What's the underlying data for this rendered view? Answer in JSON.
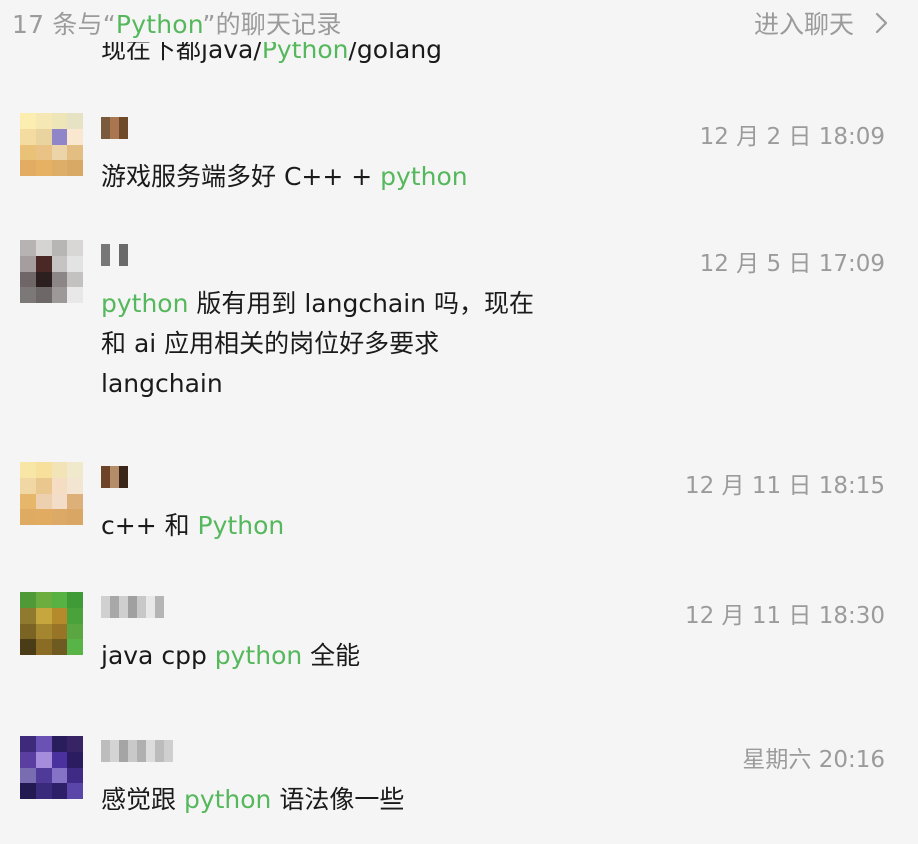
{
  "header": {
    "title_prefix": "17 条与“",
    "title_keyword": "Python",
    "title_suffix": "”的聊天记录",
    "enter_label": "进入聊天"
  },
  "cutoff_line": {
    "before": "现在下都java/",
    "keyword": "Python",
    "after": "/golang"
  },
  "messages": [
    {
      "time": "12 月 2 日 18:09",
      "avatar_colors": [
        "#fbeeb0",
        "#f6e8b5",
        "#eee5b8",
        "#e6e2c4",
        "#f4dca0",
        "#e9d49f",
        "#8f85c8",
        "#f9e7cf",
        "#e9c177",
        "#eac285",
        "#edd3a8",
        "#e2be83",
        "#e2ad62",
        "#e7b164",
        "#ddae68",
        "#d8a964"
      ],
      "name_colors": [
        "#7a5a3c",
        "#a9764f",
        "#6e4a2a"
      ],
      "parts": [
        {
          "t": "游戏服务端多好 C++ + ",
          "kw": false
        },
        {
          "t": "python",
          "kw": true
        }
      ]
    },
    {
      "time": "12 月 5 日 17:09",
      "avatar_colors": [
        "#b7b3b2",
        "#d6d3d3",
        "#b8b5b5",
        "#d8d7d6",
        "#a49f9e",
        "#4a2826",
        "#c6c3c3",
        "#e4e3e3",
        "#6f6767",
        "#2b1f1f",
        "#8c8686",
        "#c4c2c1",
        "#7c7878",
        "#6d6767",
        "#9d9999",
        "#e9e8e8"
      ],
      "name_colors": [
        "#777777",
        "#f5f5f5",
        "#6a6a6a"
      ],
      "lines": [
        [
          {
            "t": "python",
            "kw": true
          },
          {
            "t": " 版有用到 langchain 吗，现在",
            "kw": false
          }
        ],
        [
          {
            "t": "和 ai 应用相关的岗位好多要求",
            "kw": false
          }
        ],
        [
          {
            "t": "langchain",
            "kw": false
          }
        ]
      ]
    },
    {
      "time": "12 月 11 日 18:15",
      "avatar_colors": [
        "#f8e6a6",
        "#f7df9c",
        "#f3e4b8",
        "#f1e9cc",
        "#f0d7a4",
        "#e9c78f",
        "#f5ddc3",
        "#f2e5d2",
        "#e6b66b",
        "#edd0b0",
        "#f3dcc8",
        "#ddb07a",
        "#dfab63",
        "#e1ab61",
        "#dcaa66",
        "#d9a763"
      ],
      "name_colors": [
        "#6d4428",
        "#b58c68",
        "#3a2618"
      ],
      "parts": [
        {
          "t": "c++ 和 ",
          "kw": false
        },
        {
          "t": "Python",
          "kw": true
        }
      ]
    },
    {
      "time": "12 月 11 日 18:30",
      "avatar_colors": [
        "#4f9a36",
        "#6cad3f",
        "#57b243",
        "#3e9b35",
        "#8f7a2d",
        "#c6a73f",
        "#b48a2c",
        "#49a33a",
        "#7a6323",
        "#a48530",
        "#987426",
        "#5aa742",
        "#4b3c18",
        "#8a6c24",
        "#6f5a21",
        "#58b446"
      ],
      "name_colors": [
        "#d0d0d0",
        "#a8a8a8",
        "#cfcfcf",
        "#a0a0a0",
        "#c8c8c8",
        "#e8e8e8",
        "#b5b5b5"
      ],
      "parts": [
        {
          "t": "java cpp ",
          "kw": false
        },
        {
          "t": "python",
          "kw": true
        },
        {
          "t": " 全能",
          "kw": false
        }
      ]
    },
    {
      "time": "星期六 20:16",
      "avatar_colors": [
        "#3d2a7a",
        "#6a52b5",
        "#2a1d5e",
        "#362465",
        "#5a3fa0",
        "#a58ddc",
        "#4b30a0",
        "#2b1b60",
        "#7a6cb0",
        "#4f3a9a",
        "#8473c6",
        "#3f2a86",
        "#221852",
        "#3a2a7c",
        "#2e2068",
        "#5946a8"
      ],
      "name_colors": [
        "#bdbdbd",
        "#d4d4d4",
        "#a5a5a5",
        "#c9c9c9",
        "#b0b0b0",
        "#dcdcdc",
        "#bcbcbc",
        "#cfcfcf"
      ],
      "parts": [
        {
          "t": "感觉跟 ",
          "kw": false
        },
        {
          "t": "python",
          "kw": true
        },
        {
          "t": " 语法像一些",
          "kw": false
        }
      ]
    }
  ]
}
